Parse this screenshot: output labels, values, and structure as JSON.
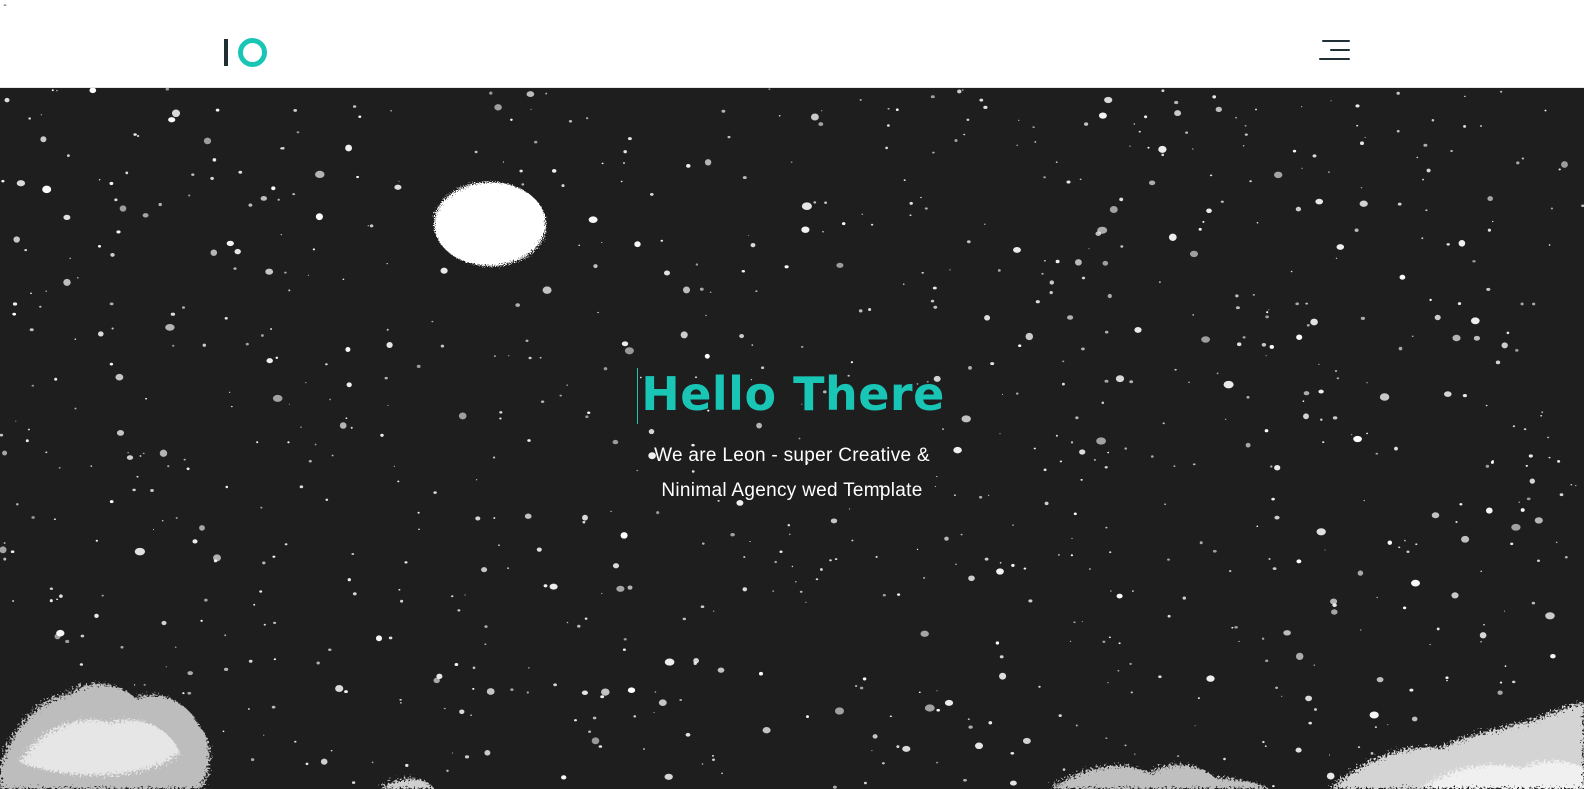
{
  "corner_mark": "-",
  "header": {
    "logo_icon": "io-logo-icon",
    "menu_icon": "hamburger-menu-icon"
  },
  "hero": {
    "title": "Hello There",
    "subtitle_line1": "We are Leon - super Creative &",
    "subtitle_line2": "Ninimal Agency wed Template"
  },
  "colors": {
    "accent": "#19c6b6",
    "dark": "#1f2f34",
    "hero_bg": "#1e1e1f",
    "text_light": "#ffffff"
  }
}
